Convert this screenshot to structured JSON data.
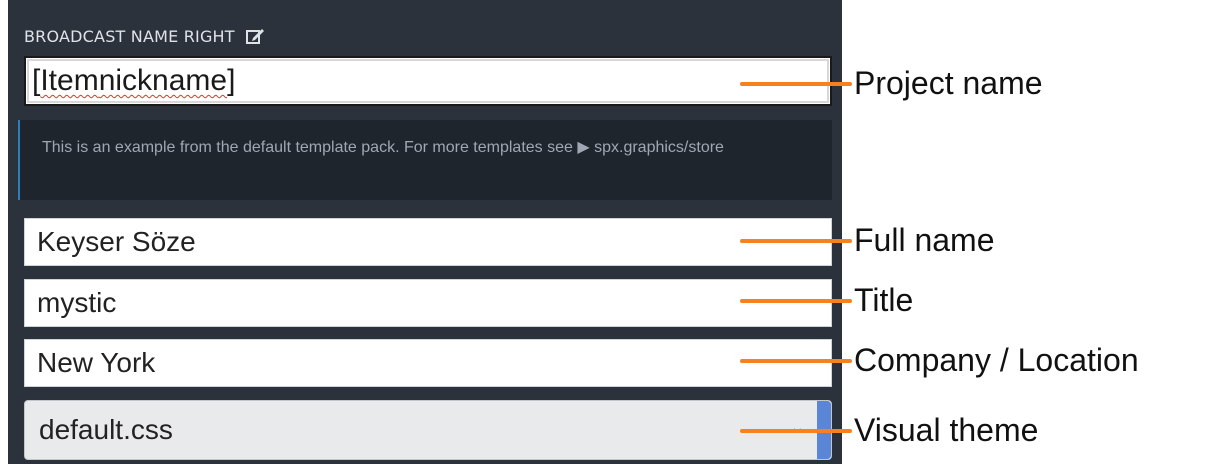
{
  "panel": {
    "header_title": "BROADCAST NAME RIGHT",
    "project_field": {
      "value": "[ Item nickname ]",
      "parts": [
        "[ ",
        "Item",
        " ",
        "nickname",
        " ]"
      ]
    },
    "info_text": "This is an example from the default template pack. For more templates see ▶ spx.graphics/store",
    "fields": [
      {
        "value": "Keyser Söze"
      },
      {
        "value": "mystic"
      },
      {
        "value": "New York"
      }
    ],
    "theme_select": {
      "value": "default.css",
      "arrow": "⌄"
    }
  },
  "annotations": [
    "Project name",
    "Full name",
    "Title",
    "Company / Location",
    "Visual theme"
  ],
  "colors": {
    "panel_bg": "#2b323c",
    "info_bg": "#1f252d",
    "annotation_line": "#f5811f",
    "select_accent": "#5b86d6"
  }
}
